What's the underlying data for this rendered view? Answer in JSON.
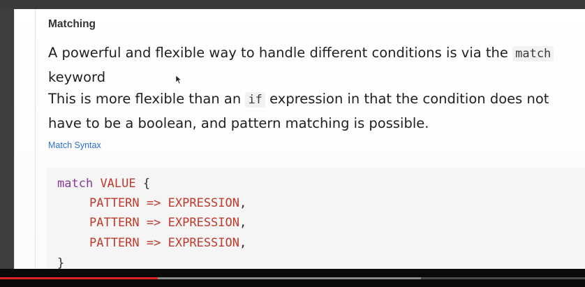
{
  "section": {
    "title": "Matching"
  },
  "intro": {
    "line1_text": "A powerful and flexible way to handle different conditions is via the ",
    "line1_code": "match",
    "line1_after": " keyword",
    "line2_before": "This is more flexible than an ",
    "line2_code": "if",
    "line2_after": " expression in that the condition does not have to be a boolean, and pattern matching is possible."
  },
  "link": {
    "label": "Match Syntax"
  },
  "code": {
    "line1": {
      "keyword": "match",
      "value": "VALUE",
      "brace": "{"
    },
    "arm": {
      "pattern": "PATTERN",
      "arrow": "=>",
      "expression": "EXPRESSION",
      "comma": ","
    },
    "line5": {
      "brace": "}"
    }
  },
  "video": {
    "played_fraction": 0.27,
    "buffered_fraction": 0.72
  },
  "colors": {
    "keyword": "#8a3a9a",
    "identifier": "#c0392b",
    "link": "#2f6fcf",
    "progress_played": "#e52222"
  }
}
